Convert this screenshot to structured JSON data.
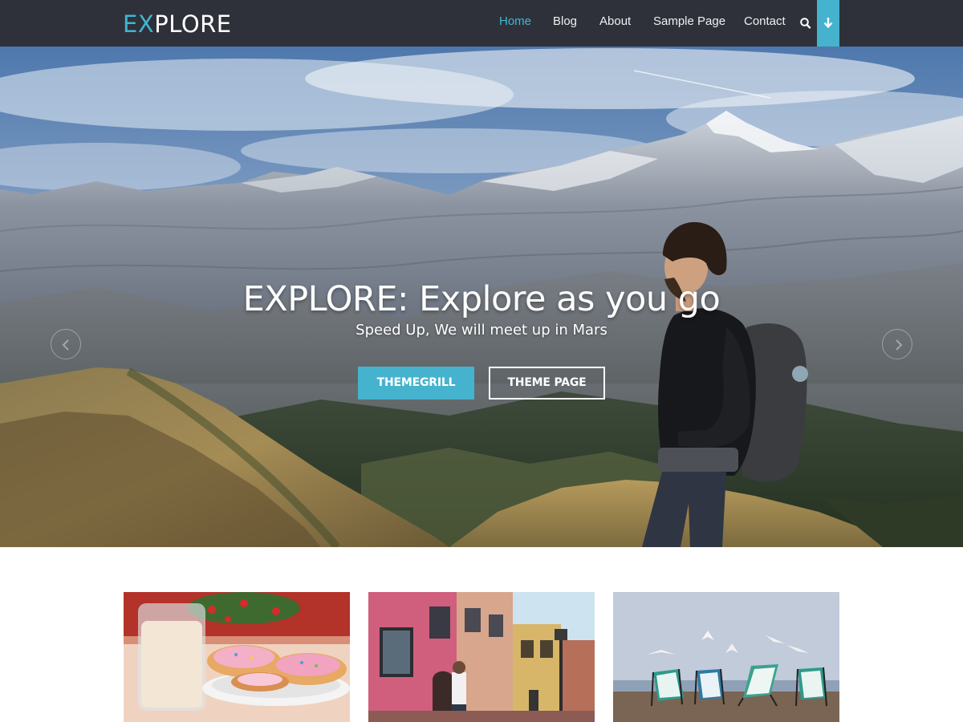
{
  "logo": {
    "accent": "EX",
    "rest": "PLORE"
  },
  "nav": {
    "items": [
      {
        "label": "Home",
        "active": true
      },
      {
        "label": "Blog",
        "active": false
      },
      {
        "label": "About",
        "active": false
      },
      {
        "label": "Sample Page",
        "active": false
      },
      {
        "label": "Contact",
        "active": false
      }
    ],
    "search_icon": "search-icon",
    "down_icon": "arrow-down-icon"
  },
  "hero": {
    "title": "EXPLORE: Explore as you go",
    "subtitle": "Speed Up, We will meet up in Mars",
    "primary_button": "THEMEGRILL",
    "secondary_button": "THEME PAGE",
    "prev_icon": "chevron-left-icon",
    "next_icon": "chevron-right-icon"
  },
  "cards": [
    {
      "image": "milk-and-cookies"
    },
    {
      "image": "old-town-street"
    },
    {
      "image": "beach-chairs-with-seagulls"
    }
  ],
  "colors": {
    "header_bg": "#2e313a",
    "accent": "#45b3ce",
    "logo_accent": "#3fb7d2",
    "nav_text": "#f0f0f0"
  }
}
